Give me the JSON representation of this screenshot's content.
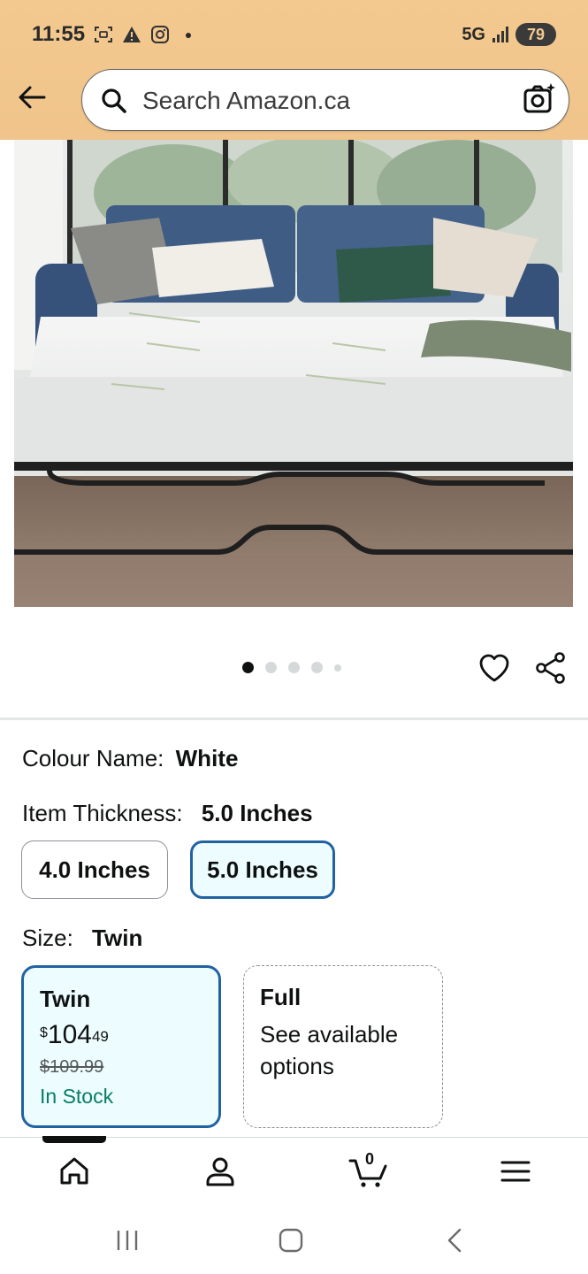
{
  "status_bar": {
    "time": "11:55",
    "network": "5G",
    "battery": "79"
  },
  "search": {
    "placeholder": "Search Amazon.ca"
  },
  "gallery": {
    "image_count": 5,
    "active_index": 0
  },
  "colour": {
    "label": "Colour Name:",
    "value": "White"
  },
  "thickness": {
    "label": "Item Thickness:",
    "value": "5.0 Inches",
    "options": [
      {
        "label": "4.0 Inches",
        "selected": false
      },
      {
        "label": "5.0 Inches",
        "selected": true
      }
    ]
  },
  "size": {
    "label": "Size:",
    "value": "Twin",
    "options": [
      {
        "title": "Twin",
        "currency": "$",
        "price_whole": "104",
        "price_cents": "49",
        "list_price": "$109.99",
        "stock": "In Stock",
        "selected": true
      },
      {
        "title": "Full",
        "note": "See available options",
        "selected": false
      }
    ]
  },
  "bottom_nav": {
    "cart_count": "0"
  },
  "colors": {
    "header_bg": "#f3c98f",
    "selected_border": "#2162a1",
    "selected_bg": "#edfdff",
    "in_stock": "#067d62"
  }
}
